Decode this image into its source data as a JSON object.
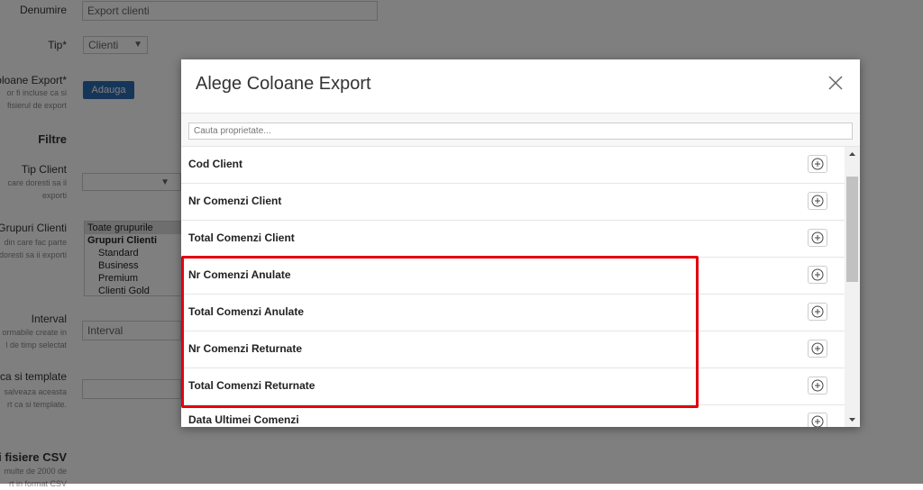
{
  "background_form": {
    "name_label": "Denumire",
    "name_value": "Export clienti",
    "type_label": "Tip*",
    "type_value": "Clienti",
    "columns_label": "oloane Export*",
    "columns_sub1": "or fi incluse ca si",
    "columns_sub2": "fisierul de export",
    "add_button": "Adauga",
    "filters_title": "Filtre",
    "client_type_label": "Tip Client",
    "client_type_sub1": "care doresti sa il",
    "client_type_sub2": "exporti",
    "groups_label": "Grupuri Clienti",
    "groups_sub1": "din care fac parte",
    "groups_sub2": "doresti sa ii exporti",
    "groups_options": [
      "Toate grupurile",
      "Grupuri Clienti",
      "Standard",
      "Business",
      "Premium",
      "Clienti Gold"
    ],
    "interval_label": "Interval",
    "interval_sub1": "ormabile create in",
    "interval_sub2": "l de timp selectat",
    "interval_placeholder": "Interval",
    "template_label": "ca si template",
    "template_sub1": "salveaza aceasta",
    "template_sub2": "rt ca si template.",
    "csv_title": "ni fisiere CSV",
    "csv_sub1": "multe de 2000 de",
    "csv_sub2": "rt in format CSV"
  },
  "modal": {
    "title": "Alege Coloane Export",
    "search_placeholder": "Cauta proprietate...",
    "properties": [
      "Cod Client",
      "Nr Comenzi Client",
      "Total Comenzi Client",
      "Nr Comenzi Anulate",
      "Total Comenzi Anulate",
      "Nr Comenzi Returnate",
      "Total Comenzi Returnate",
      "Data Ultimei Comenzi"
    ]
  },
  "colors": {
    "highlight": "#e3000f",
    "accent_button": "#2d6db3",
    "overlay": "rgba(0,0,0,0.5)"
  },
  "icons": {
    "close": "close-icon",
    "add": "plus-circle-icon",
    "scroll_up": "triangle-up-icon",
    "scroll_down": "triangle-down-icon"
  }
}
